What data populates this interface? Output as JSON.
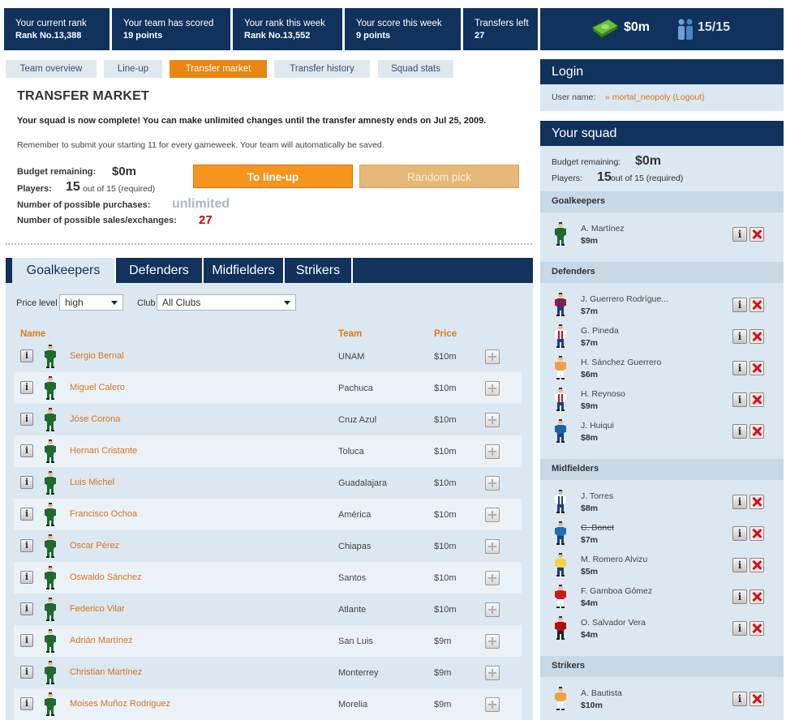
{
  "stats": {
    "current_rank_label": "Your current rank",
    "current_rank_value": "Rank No.13,388",
    "team_scored_label": "Your team has scored",
    "team_scored_value": "19 points",
    "rank_week_label": "Your rank this week",
    "rank_week_value": "Rank No.13,552",
    "score_week_label": "Your score this week",
    "score_week_value": "9 points",
    "transfers_left_label": "Transfers left",
    "transfers_left_value": "27",
    "money": "$0m",
    "squad_count": "15/15"
  },
  "tabs": [
    "Team overview",
    "Line-up",
    "Transfer market",
    "Transfer history",
    "Squad stats"
  ],
  "active_tab": "Transfer market",
  "market": {
    "title": "TRANSFER MARKET",
    "complete_msg": "Your squad is now complete! You can make unlimited changes until the transfer amnesty ends on Jul 25, 2009.",
    "remember_msg": "Remember to submit your starting 11 for every gameweek. Your team will automatically be saved.",
    "budget_label": "Budget remaining:",
    "budget_value": "$0m",
    "players_label": "Players:",
    "players_count": "15",
    "players_suffix": "out of 15 (required)",
    "purchases_label": "Number of possible purchases:",
    "purchases_value": "unlimited",
    "sales_label": "Number of possible sales/exchanges:",
    "sales_value": "27",
    "lineup_button": "To line-up",
    "random_button": "Random pick"
  },
  "position_tabs": [
    "Goalkeepers",
    "Defenders",
    "Midfielders",
    "Strikers"
  ],
  "filters": {
    "price_label": "Price level",
    "price_value": "high",
    "club_label": "Club",
    "club_value": "All Clubs"
  },
  "columns": {
    "name": "Name",
    "team": "Team",
    "price": "Price"
  },
  "players": [
    {
      "name": "Sergio Bernal",
      "team": "UNAM",
      "price": "$10m"
    },
    {
      "name": "Miguel Calero",
      "team": "Pachuca",
      "price": "$10m"
    },
    {
      "name": "Jóse Corona",
      "team": "Cruz Azul",
      "price": "$10m"
    },
    {
      "name": "Hernan Cristante",
      "team": "Toluca",
      "price": "$10m"
    },
    {
      "name": "Luis Michel",
      "team": "Guadalajara",
      "price": "$10m"
    },
    {
      "name": "Francisco Ochoa",
      "team": "América",
      "price": "$10m"
    },
    {
      "name": "Oscar Pérez",
      "team": "Chiapas",
      "price": "$10m"
    },
    {
      "name": "Oswaldo Sánchez",
      "team": "Santos",
      "price": "$10m"
    },
    {
      "name": "Federico Vilar",
      "team": "Atlante",
      "price": "$10m"
    },
    {
      "name": "Adrián Martínez",
      "team": "San Luis",
      "price": "$9m"
    },
    {
      "name": "Christian Martínez",
      "team": "Monterrey",
      "price": "$9m"
    },
    {
      "name": "Moises Muñoz Rodriguez",
      "team": "Morelia",
      "price": "$9m"
    }
  ],
  "login": {
    "title": "Login",
    "user_label": "User name:",
    "user_value": "» mortal_neopoly (Logout)"
  },
  "squad": {
    "title": "Your squad",
    "budget_label": "Budget remaining:",
    "budget_value": "$0m",
    "players_label": "Players:",
    "players_count": "15",
    "players_suffix": "out of 15 (required)",
    "groups": [
      {
        "name": "Goalkeepers",
        "players": [
          {
            "name": "A. Martínez",
            "price": "$9m"
          }
        ]
      },
      {
        "name": "Defenders",
        "players": [
          {
            "name": "J. Guerrero Rodrígue...",
            "price": "$7m"
          },
          {
            "name": "G. Pineda",
            "price": "$7m"
          },
          {
            "name": "H. Sánchez Guerrero",
            "price": "$6m"
          },
          {
            "name": "H. Reynoso",
            "price": "$9m"
          },
          {
            "name": "J. Huiqui",
            "price": "$8m"
          }
        ]
      },
      {
        "name": "Midfielders",
        "players": [
          {
            "name": "J. Torres",
            "price": "$8m"
          },
          {
            "name": "C. Bonet",
            "price": "$7m"
          },
          {
            "name": "M. Romero Alvizu",
            "price": "$5m"
          },
          {
            "name": "F. Gamboa Gómez",
            "price": "$4m"
          },
          {
            "name": "O. Salvador Vera",
            "price": "$4m"
          }
        ]
      },
      {
        "name": "Strikers",
        "players": [
          {
            "name": "A. Bautista",
            "price": "$10m"
          }
        ]
      }
    ]
  },
  "colors": {
    "navy": "#10325c",
    "orange": "#f7941d",
    "link": "#d9741c",
    "panel": "#dbe7f1",
    "red": "#cc0000",
    "grey": "#a8b7c7"
  }
}
